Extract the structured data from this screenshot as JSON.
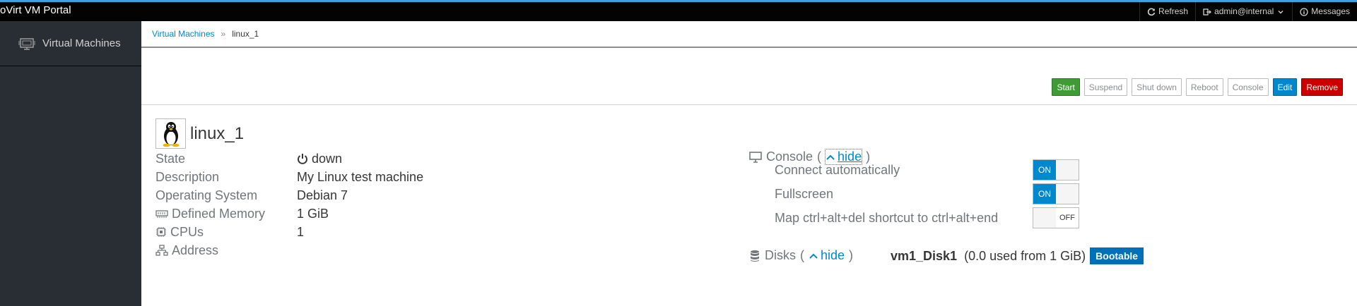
{
  "app": {
    "title": "oVirt VM Portal"
  },
  "topnav": {
    "refresh": "Refresh",
    "user": "admin@internal",
    "messages": "Messages"
  },
  "sidebar": {
    "items": [
      {
        "label": "Virtual Machines",
        "icon": "virtual-machine-icon"
      }
    ]
  },
  "breadcrumb": {
    "root": "Virtual Machines",
    "separator": "»",
    "current": "linux_1"
  },
  "toolbar": {
    "start": "Start",
    "suspend": "Suspend",
    "shutdown": "Shut down",
    "reboot": "Reboot",
    "console": "Console",
    "edit": "Edit",
    "remove": "Remove"
  },
  "vm": {
    "name": "linux_1",
    "os_icon": "linux-tux-icon",
    "properties": {
      "state": {
        "label": "State",
        "value": "down",
        "icon": "power-icon"
      },
      "description": {
        "label": "Description",
        "value": "My Linux test machine"
      },
      "os": {
        "label": "Operating System",
        "value": "Debian 7"
      },
      "memory": {
        "label": "Defined Memory",
        "value": "1 GiB",
        "icon": "memory-icon"
      },
      "cpus": {
        "label": "CPUs",
        "value": "1",
        "icon": "cpu-icon"
      },
      "address": {
        "label": "Address",
        "value": "",
        "icon": "network-icon"
      }
    }
  },
  "console": {
    "title": "Console",
    "hide_link": "hide",
    "options": [
      {
        "label": "Connect automatically",
        "state": "ON"
      },
      {
        "label": "Fullscreen",
        "state": "ON"
      },
      {
        "label": "Map ctrl+alt+del shortcut to ctrl+alt+end",
        "state": "OFF"
      }
    ]
  },
  "disks": {
    "title": "Disks",
    "hide_link": "hide",
    "items": [
      {
        "name": "vm1_Disk1",
        "usage": "(0.0 used from 1 GiB)",
        "badge": "Bootable"
      }
    ]
  },
  "colors": {
    "accent": "#0088ce",
    "start": "#3f9c35",
    "remove": "#cc0000",
    "sidebar": "#292e34",
    "topbar": "#030303"
  }
}
